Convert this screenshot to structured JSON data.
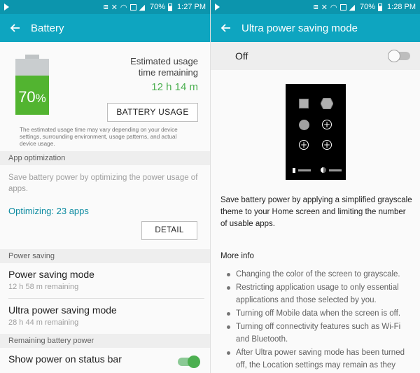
{
  "status_left": {
    "battery_pct": "70%",
    "time": "1:27 PM"
  },
  "status_right": {
    "battery_pct": "70%",
    "time": "1:28 PM"
  },
  "battery_screen": {
    "title": "Battery",
    "battery_level_percent": 70,
    "battery_percent_text": "70",
    "battery_percent_symbol": "%",
    "estimated_label_line1": "Estimated usage",
    "estimated_label_line2": "time remaining",
    "estimated_time": "12 h 14 m",
    "battery_usage_button": "BATTERY USAGE",
    "disclaimer": "The estimated usage time may vary depending on your device settings, surrounding environment, usage patterns, and actual device usage.",
    "app_optimization_header": "App optimization",
    "app_optimization_desc": "Save battery power by optimizing the power usage of apps.",
    "optimizing_status": "Optimizing: 23 apps",
    "detail_button": "DETAIL",
    "power_saving_header": "Power saving",
    "power_saving_mode": {
      "title": "Power saving mode",
      "sub": "12 h 58 m remaining"
    },
    "ultra_power_saving_mode": {
      "title": "Ultra power saving mode",
      "sub": "28 h 44 m remaining"
    },
    "remaining_battery_header": "Remaining battery power",
    "show_power_label": "Show power on status bar",
    "show_power_on": true
  },
  "ultra_screen": {
    "title": "Ultra power saving mode",
    "switch_label": "Off",
    "switch_on": false,
    "description": "Save battery power by applying a simplified grayscale theme to your Home screen and limiting the number of usable apps.",
    "more_info_label": "More info",
    "bullets": [
      "Changing the color of the screen to grayscale.",
      "Restricting application usage to only essential applications and those selected by you.",
      "Turning off Mobile data when the screen is off.",
      "Turning off connectivity features such as Wi-Fi and Bluetooth.",
      "After Ultra power saving mode has been turned off, the Location settings may remain as they"
    ]
  },
  "colors": {
    "status_bar": "#0c95ad",
    "app_bar": "#0ea5c0",
    "battery_fill": "#52b430",
    "accent_green": "#4caf50",
    "accent_teal": "#0b8aa0"
  }
}
